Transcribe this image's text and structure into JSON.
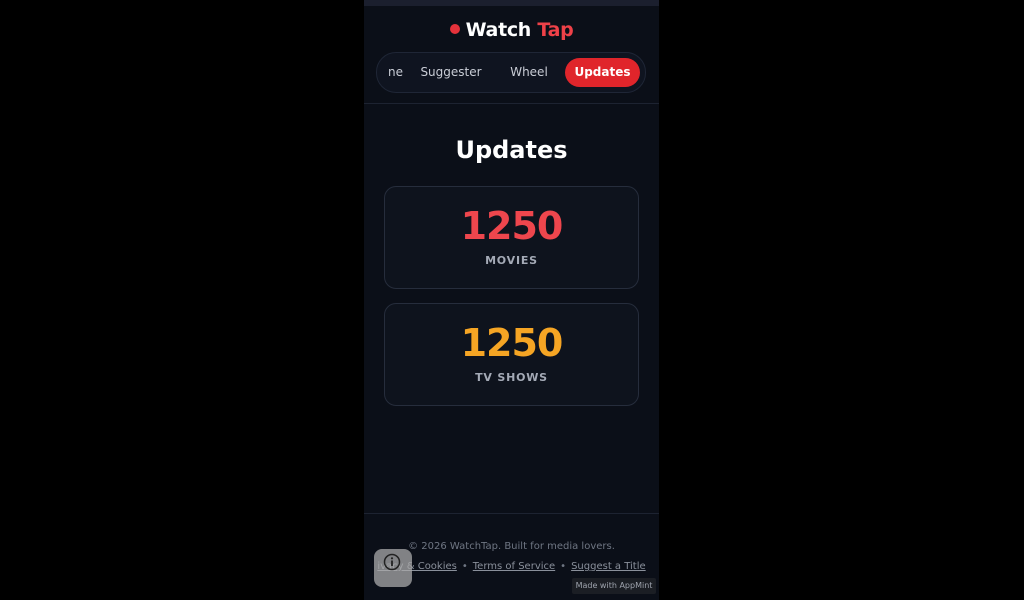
{
  "brand": {
    "name_main": "Watch",
    "name_accent": "Tap",
    "dot_color": "#e5323b",
    "accent_color": "#ef4148"
  },
  "nav": {
    "items": [
      {
        "label": "ne"
      },
      {
        "label": "Suggester"
      },
      {
        "label": "Wheel"
      },
      {
        "label": "Updates",
        "active": true
      }
    ],
    "active_color": "#e0252b"
  },
  "page": {
    "title": "Updates"
  },
  "stats": [
    {
      "value": "1250",
      "label": "MOVIES",
      "color": "#ee464d"
    },
    {
      "value": "1250",
      "label": "TV SHOWS",
      "color": "#f5a524"
    }
  ],
  "footer": {
    "copyright": "© 2026 WatchTap. Built for media lovers.",
    "links": [
      {
        "label": "ivacy & Cookies"
      },
      {
        "label": "Terms of Service"
      },
      {
        "label": "Suggest a Title"
      }
    ],
    "separator": "•"
  },
  "overlay": {
    "info_icon": "info-icon",
    "made_with": "Made with AppMint"
  }
}
